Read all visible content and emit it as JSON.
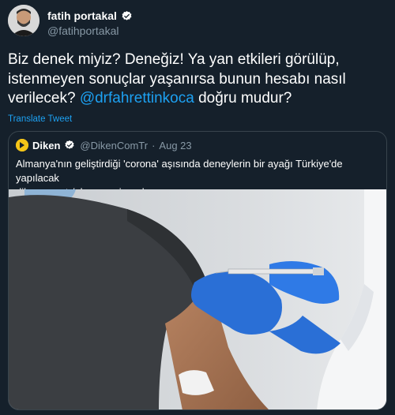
{
  "author": {
    "name": "fatih portakal",
    "handle": "@fatihportakal"
  },
  "tweet": {
    "text_part1": "Biz denek miyiz? Deneğiz! Ya yan etkileri görülüp, istenmeyen sonuçlar yaşanırsa bunun hesabı nasıl verilecek? ",
    "mention": "@drfahrettinkoca",
    "text_part2": " doğru mudur?",
    "translate_label": "Translate Tweet"
  },
  "quote": {
    "name": "Diken",
    "handle": "@DikenComTr",
    "separator": "·",
    "date": "Aug 23",
    "text_line1": "Almanya'nın geliştirdiği 'corona' aşısında deneylerin bir ayağı Türkiye'de yapılacak",
    "text_line2": "diken.com.tr/almanyanin-gel..."
  },
  "colors": {
    "background": "#15202b",
    "accent": "#1da1f2",
    "secondary_text": "#8899a6",
    "border": "#38444d"
  },
  "icons": {
    "verified": "verified-badge-icon",
    "quote_logo": "diken-logo-icon"
  }
}
